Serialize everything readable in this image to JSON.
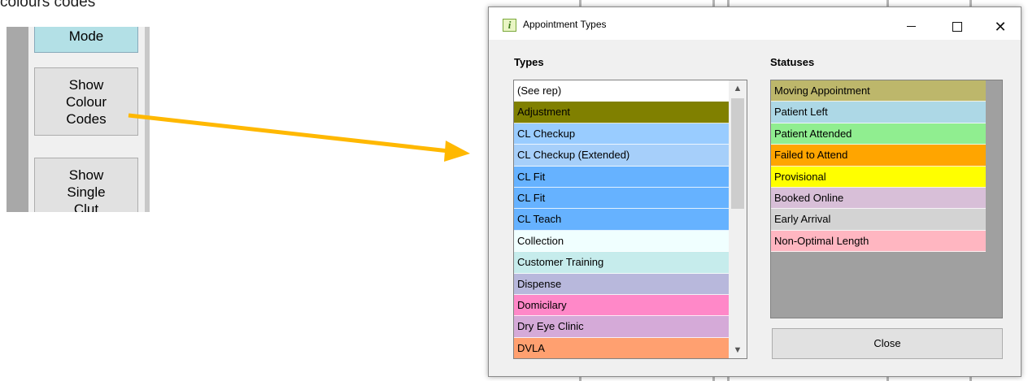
{
  "caption": "colours codes",
  "snippet": {
    "mode_label": "Mode",
    "colour_button": [
      "Show",
      "Colour",
      "Codes"
    ],
    "single_button": [
      "Show",
      "Single",
      "Clut"
    ]
  },
  "dialog": {
    "title": "Appointment Types",
    "icon_glyph": "i",
    "minimize": "–",
    "close_glyph": "✕",
    "types_label": "Types",
    "statuses_label": "Statuses",
    "close_button": "Close",
    "types": [
      {
        "label": "(See rep)",
        "color": "#ffffff"
      },
      {
        "label": "Adjustment",
        "color": "#808000"
      },
      {
        "label": "CL Checkup",
        "color": "#99ccff"
      },
      {
        "label": "CL Checkup (Extended)",
        "color": "#a6cffa"
      },
      {
        "label": "CL Fit",
        "color": "#66b2ff"
      },
      {
        "label": "CL Fit",
        "color": "#66b2ff"
      },
      {
        "label": "CL Teach",
        "color": "#66b2ff"
      },
      {
        "label": "Collection",
        "color": "#f0ffff"
      },
      {
        "label": "Customer Training",
        "color": "#c6ecec"
      },
      {
        "label": "Dispense",
        "color": "#b8b8dc"
      },
      {
        "label": "Domicilary",
        "color": "#ff88c8"
      },
      {
        "label": "Dry Eye Clinic",
        "color": "#d5aad8"
      },
      {
        "label": "DVLA",
        "color": "#ffa070"
      }
    ],
    "statuses": [
      {
        "label": "Moving Appointment",
        "color": "#bdb76b"
      },
      {
        "label": "Patient Left",
        "color": "#add8e6"
      },
      {
        "label": "Patient Attended",
        "color": "#90ee90"
      },
      {
        "label": "Failed to Attend",
        "color": "#ffa500"
      },
      {
        "label": "Provisional",
        "color": "#ffff00"
      },
      {
        "label": "Booked Online",
        "color": "#d8bfd8"
      },
      {
        "label": "Early Arrival",
        "color": "#d3d3d3"
      },
      {
        "label": "Non-Optimal Length",
        "color": "#ffb6c1"
      }
    ]
  },
  "colors": {
    "arrow": "#ffb800"
  }
}
